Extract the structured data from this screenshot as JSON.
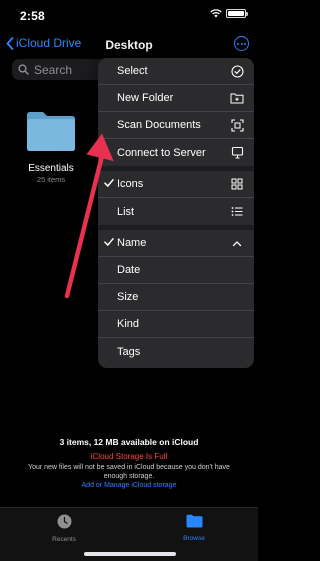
{
  "status_bar": {
    "time": "2:58",
    "battery_level": 1.0
  },
  "nav": {
    "back_label": "iCloud Drive",
    "title": "Desktop"
  },
  "search": {
    "placeholder": "Search"
  },
  "folders": [
    {
      "name": "Essentials",
      "meta": "25 items"
    }
  ],
  "menu": {
    "actions": [
      {
        "label": "Select",
        "icon": "checkmark-circle-icon"
      },
      {
        "label": "New Folder",
        "icon": "folder-plus-icon"
      },
      {
        "label": "Scan Documents",
        "icon": "scan-document-icon"
      },
      {
        "label": "Connect to Server",
        "icon": "monitor-icon"
      }
    ],
    "view": [
      {
        "label": "Icons",
        "icon": "grid-icon",
        "checked": true
      },
      {
        "label": "List",
        "icon": "list-icon",
        "checked": false
      }
    ],
    "sort": [
      {
        "label": "Name",
        "icon": "chevron-up-icon",
        "checked": true
      },
      {
        "label": "Date",
        "checked": false
      },
      {
        "label": "Size",
        "checked": false
      },
      {
        "label": "Kind",
        "checked": false
      },
      {
        "label": "Tags",
        "checked": false
      }
    ]
  },
  "storage": {
    "summary": "3 items, 12 MB available on iCloud",
    "warning": "iCloud Storage Is Full",
    "detail": "Your new files will not be saved in iCloud because you don't have enough storage.",
    "link": "Add or Manage iCloud storage"
  },
  "tabs": [
    {
      "label": "Recents",
      "icon": "clock-icon",
      "active": false
    },
    {
      "label": "Browse",
      "icon": "folder-icon",
      "active": true
    }
  ],
  "colors": {
    "accent": "#2a86ff",
    "warning": "#ff453a",
    "annotation": "#e8314f",
    "folder": "#7ab8e0"
  }
}
